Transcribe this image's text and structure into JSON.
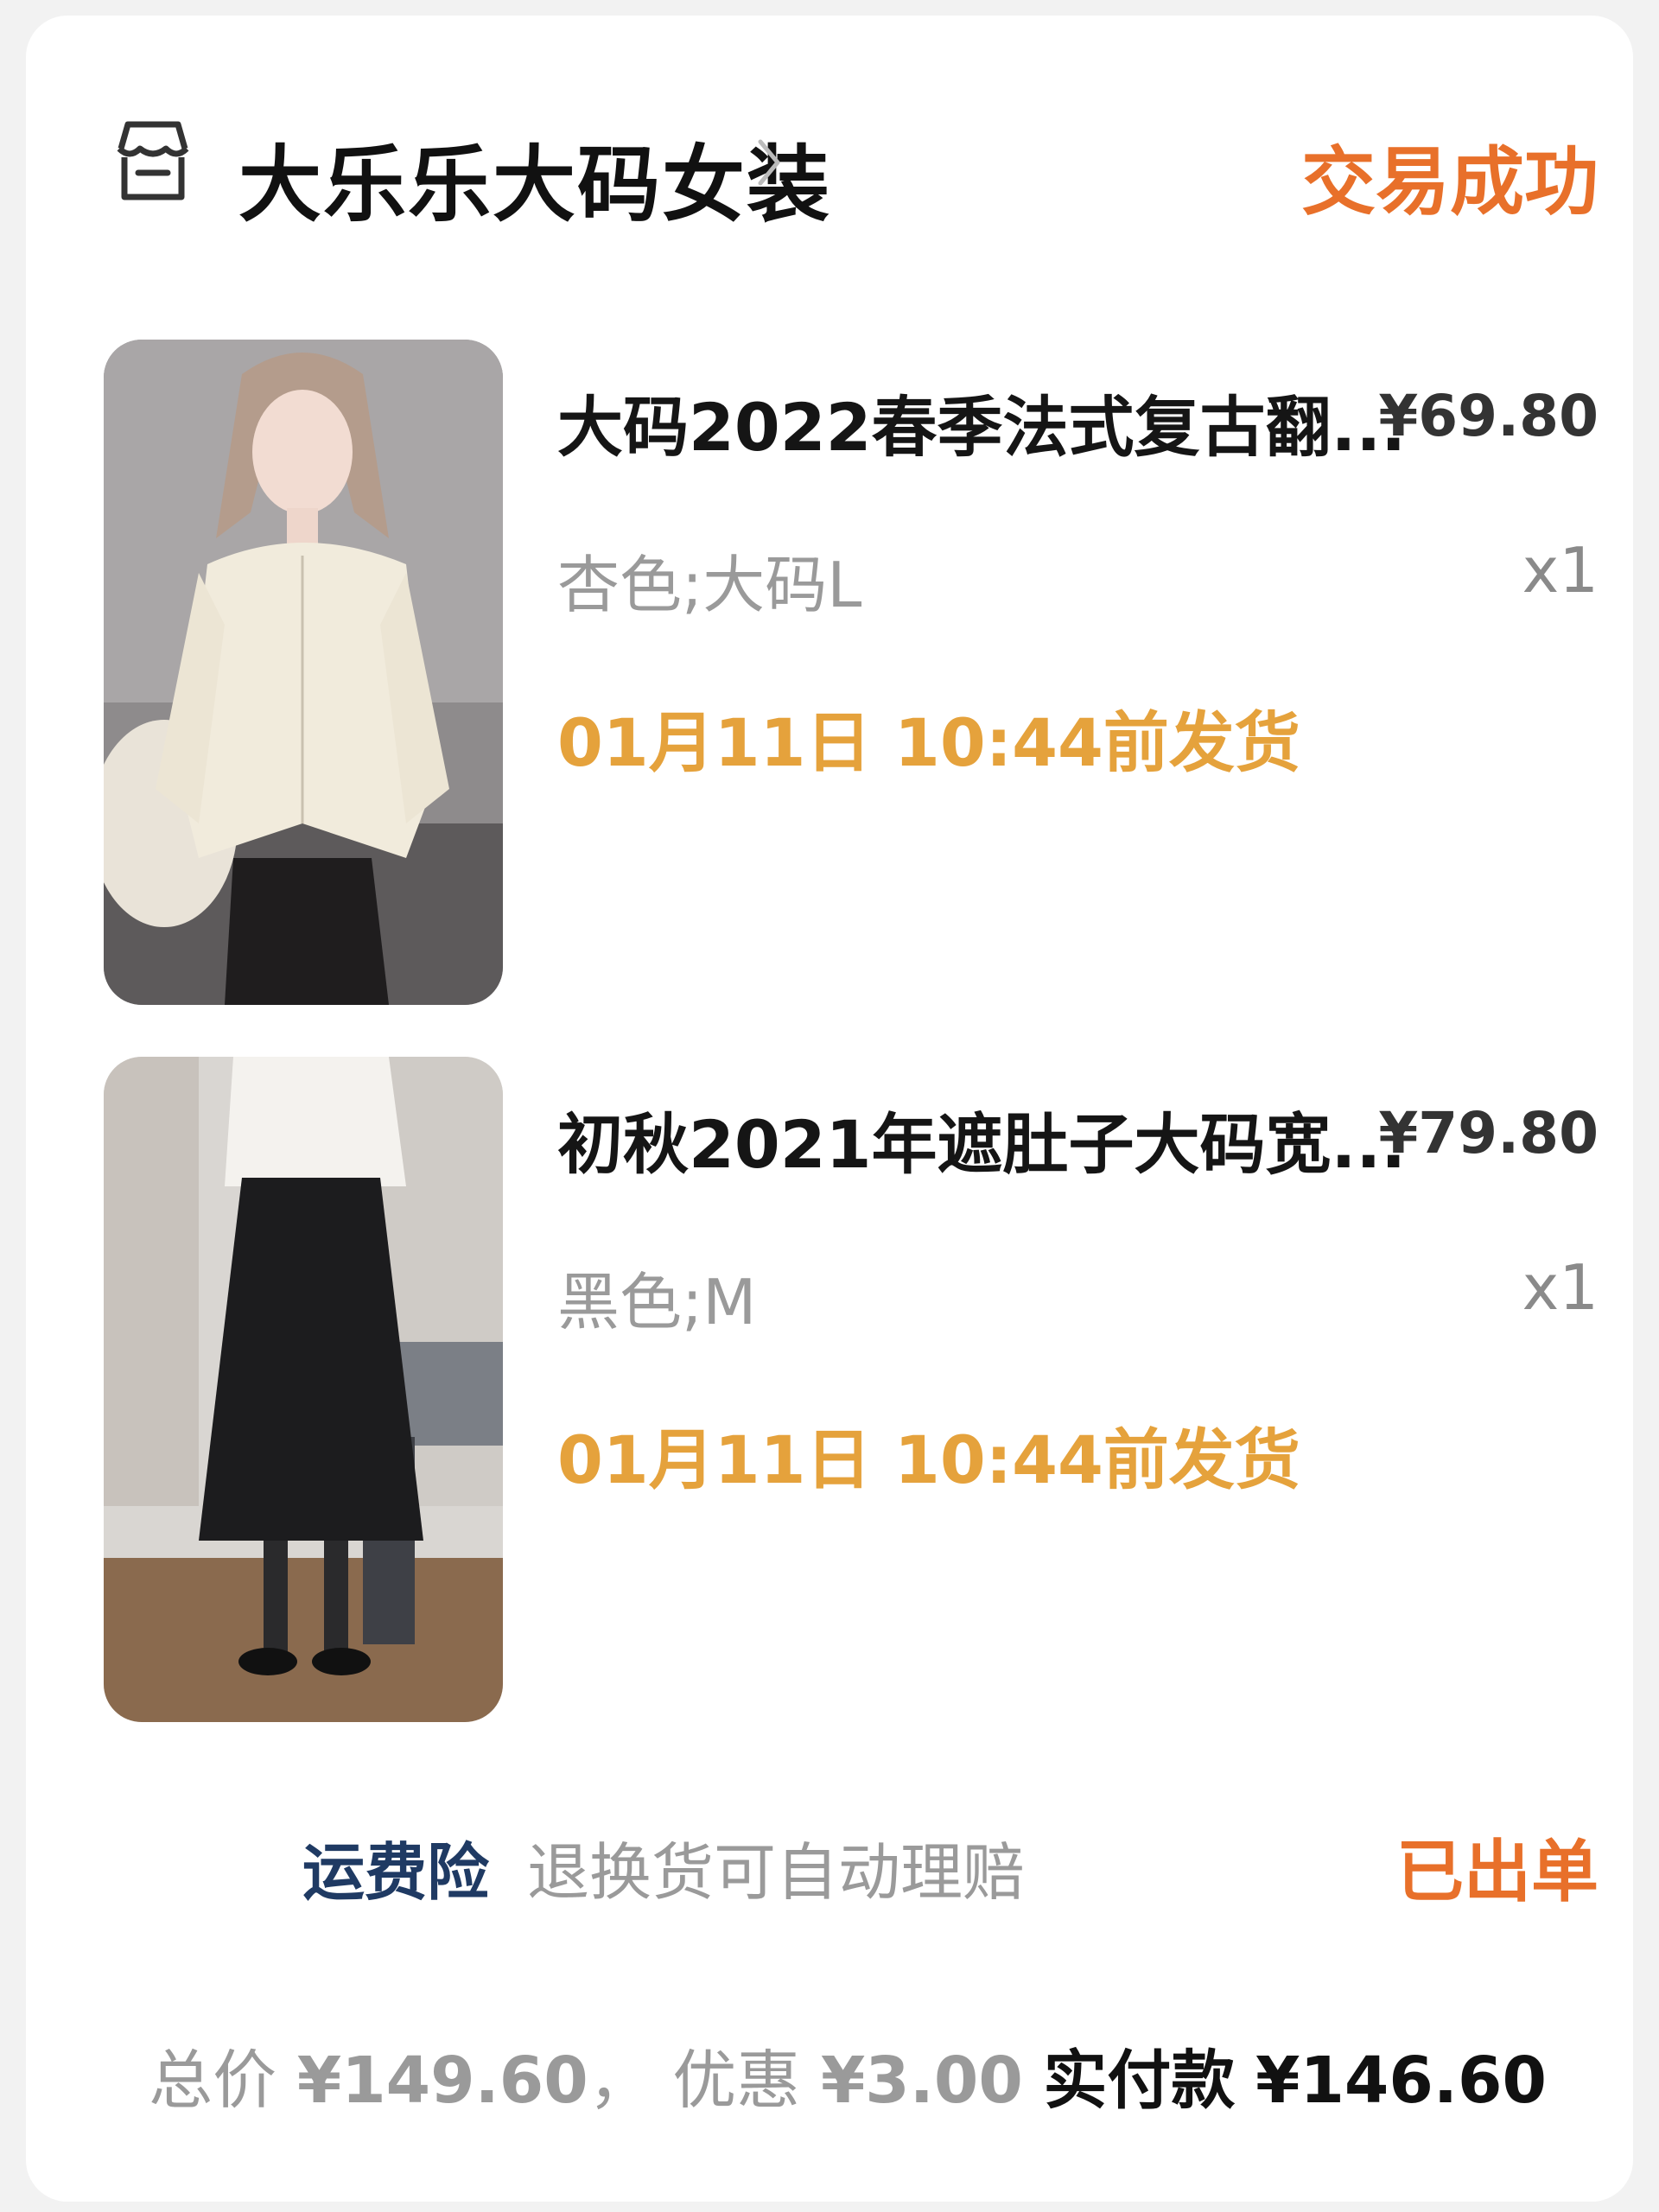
{
  "shop": {
    "name": "大乐乐大码女装",
    "status": "交易成功",
    "icon": "shop-icon"
  },
  "items": [
    {
      "title": "大码2022春季法式复古翻...",
      "price": "¥69.80",
      "sku": "杏色;大码L",
      "qty": "x1",
      "ship": "01月11日 10:44前发货"
    },
    {
      "title": "初秋2021年遮肚子大码宽...",
      "price": "¥79.80",
      "sku": "黑色;M",
      "qty": "x1",
      "ship": "01月11日 10:44前发货"
    }
  ],
  "insurance": {
    "name": "运费险",
    "description": "退换货可自动理赔",
    "status": "已出单"
  },
  "totals": {
    "total_label": "总价",
    "total": "¥149.60",
    "separator": "，",
    "discount_label": "优惠",
    "discount": "¥3.00",
    "paid_label": "实付款",
    "paid": "¥146.60"
  },
  "colors": {
    "accent": "#e8702a",
    "ship": "#e5a23c",
    "insurance": "#1f3a63"
  }
}
